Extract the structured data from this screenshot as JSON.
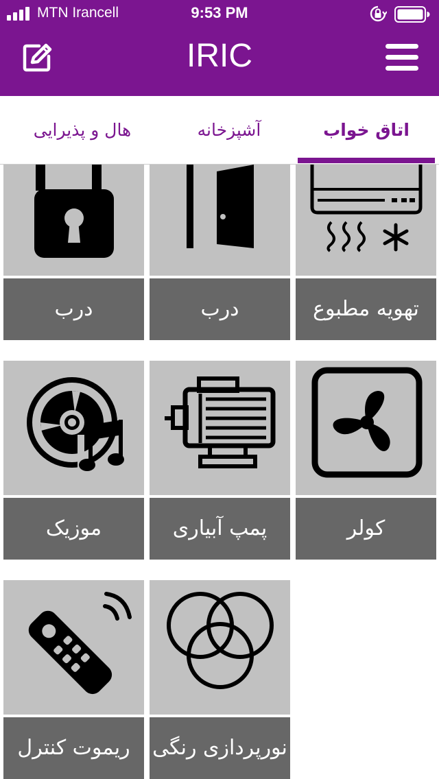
{
  "status_bar": {
    "carrier": "MTN Irancell",
    "time": "9:53 PM",
    "icons": [
      "signal-icon",
      "orientation-lock-icon",
      "battery-icon"
    ]
  },
  "app_bar": {
    "title": "IRIC",
    "left_icon": "edit-icon",
    "right_icon": "menu-icon"
  },
  "tabs": [
    {
      "label": "اتاق خواب",
      "selected": true
    },
    {
      "label": "آشپزخانه",
      "selected": false
    },
    {
      "label": "هال و پذیرایی",
      "selected": false
    }
  ],
  "devices": [
    {
      "label": "تهویه مطبوع",
      "icon": "air-conditioner-icon"
    },
    {
      "label": "درب",
      "icon": "door-icon"
    },
    {
      "label": "درب",
      "icon": "padlock-icon"
    },
    {
      "label": "کولر",
      "icon": "fan-icon"
    },
    {
      "label": "پمپ آبیاری",
      "icon": "motor-pump-icon"
    },
    {
      "label": "موزیک",
      "icon": "music-disc-icon"
    },
    {
      "label": "نورپردازی رنگی",
      "icon": "color-lighting-icon"
    },
    {
      "label": "ریموت کنترل",
      "icon": "remote-control-icon"
    }
  ],
  "colors": {
    "primary": "#7b1590",
    "tile_icon_bg": "#c1c1c1",
    "tile_label_bg": "#676767"
  }
}
